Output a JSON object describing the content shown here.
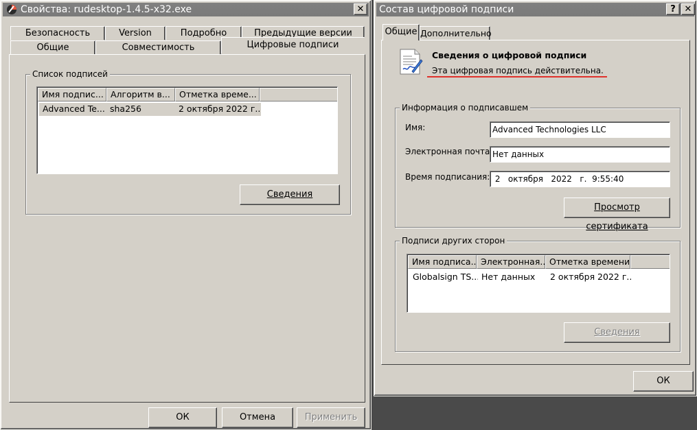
{
  "left_window": {
    "title": "Свойства: rudesktop-1.4.5-x32.exe",
    "tabs_row1": [
      "Безопасность",
      "Version",
      "Подробно",
      "Предыдущие версии"
    ],
    "tabs_row2": [
      "Общие",
      "Совместимость",
      "Цифровые подписи"
    ],
    "group_label": "Список подписей",
    "columns": [
      "Имя подпис...",
      "Алгоритм в...",
      "Отметка време..."
    ],
    "rows": [
      [
        "Advanced Te...",
        "sha256",
        "2 октября 2022 г..."
      ]
    ],
    "details_button": "Сведения",
    "ok_button": "ОК",
    "cancel_button": "Отмена",
    "apply_button": "Применить"
  },
  "right_window": {
    "title": "Состав цифровой подписи",
    "help_button": "?",
    "close_button": "✕",
    "tabs": [
      "Общие",
      "Дополнительно"
    ],
    "heading": "Сведения о цифровой подписи",
    "status": "Эта цифровая подпись действительна.",
    "signer_group": "Информация о подписавшем",
    "name_label": "Имя:",
    "name_value": "Advanced Technologies LLC",
    "email_label": "Электронная почта:",
    "email_value": "Нет данных",
    "time_label": "Время подписания:",
    "time_value": " 2   октября   2022   г.  9:55:40",
    "view_cert_button": "Просмотр сертификата",
    "countersig_group": "Подписи других сторон",
    "columns": [
      "Имя подписа...",
      "Электронная...",
      "Отметка времени"
    ],
    "rows": [
      [
        "Globalsign TS...",
        "Нет данных",
        "2 октября 2022 г..."
      ]
    ],
    "details_button": "Сведения",
    "ok_button": "ОК"
  },
  "colors": {
    "window_face": "#d4d0c8",
    "titlebar": "#808080",
    "status_underline": "#e0302a",
    "selection_row": "#d4d0c8"
  },
  "icons": {
    "app_icon": "app-icon",
    "signature_icon": "certificate-document-icon"
  }
}
